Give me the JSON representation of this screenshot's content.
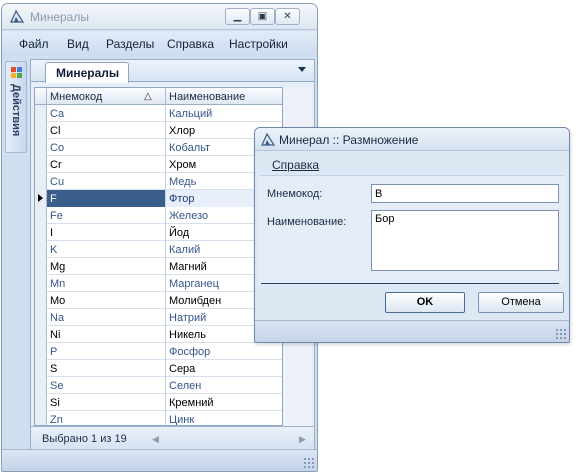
{
  "main_window": {
    "title": "Минералы",
    "menu": [
      "Файл",
      "Вид",
      "Разделы",
      "Справка",
      "Настройки"
    ],
    "sidebar_label": "Действия",
    "tab_label": "Минералы",
    "columns": {
      "code": "Мнемокод",
      "name": "Наименование"
    },
    "rows": [
      {
        "code": "Ca",
        "name": "Кальций"
      },
      {
        "code": "Cl",
        "name": "Хлор"
      },
      {
        "code": "Co",
        "name": "Кобальт"
      },
      {
        "code": "Cr",
        "name": "Хром"
      },
      {
        "code": "Cu",
        "name": "Медь"
      },
      {
        "code": "F",
        "name": "Фтор"
      },
      {
        "code": "Fe",
        "name": "Железо"
      },
      {
        "code": "I",
        "name": "Йод"
      },
      {
        "code": "K",
        "name": "Калий"
      },
      {
        "code": "Mg",
        "name": "Магний"
      },
      {
        "code": "Mn",
        "name": "Марганец"
      },
      {
        "code": "Mo",
        "name": "Молибден"
      },
      {
        "code": "Na",
        "name": "Натрий"
      },
      {
        "code": "Ni",
        "name": "Никель"
      },
      {
        "code": "P",
        "name": "Фосфор"
      },
      {
        "code": "S",
        "name": "Сера"
      },
      {
        "code": "Se",
        "name": "Селен"
      },
      {
        "code": "Si",
        "name": "Кремний"
      },
      {
        "code": "Zn",
        "name": "Цинк"
      }
    ],
    "selected_row": 5,
    "status": "Выбрано 1 из 19"
  },
  "dialog": {
    "title": "Минерал :: Размножение",
    "menu_help": "Справка",
    "code_label": "Мнемокод:",
    "code_value": "B",
    "name_label": "Наименование:",
    "name_value": "Бор",
    "ok_label": "OK",
    "cancel_label": "Отмена"
  },
  "colors": {
    "accent": "#3a5e8c",
    "window_bg": "#cfdff0"
  },
  "icons": [
    "app-icon",
    "minimize-icon",
    "maximize-icon",
    "close-icon",
    "actions-icon",
    "dropdown-icon",
    "sort-ascending-icon"
  ]
}
